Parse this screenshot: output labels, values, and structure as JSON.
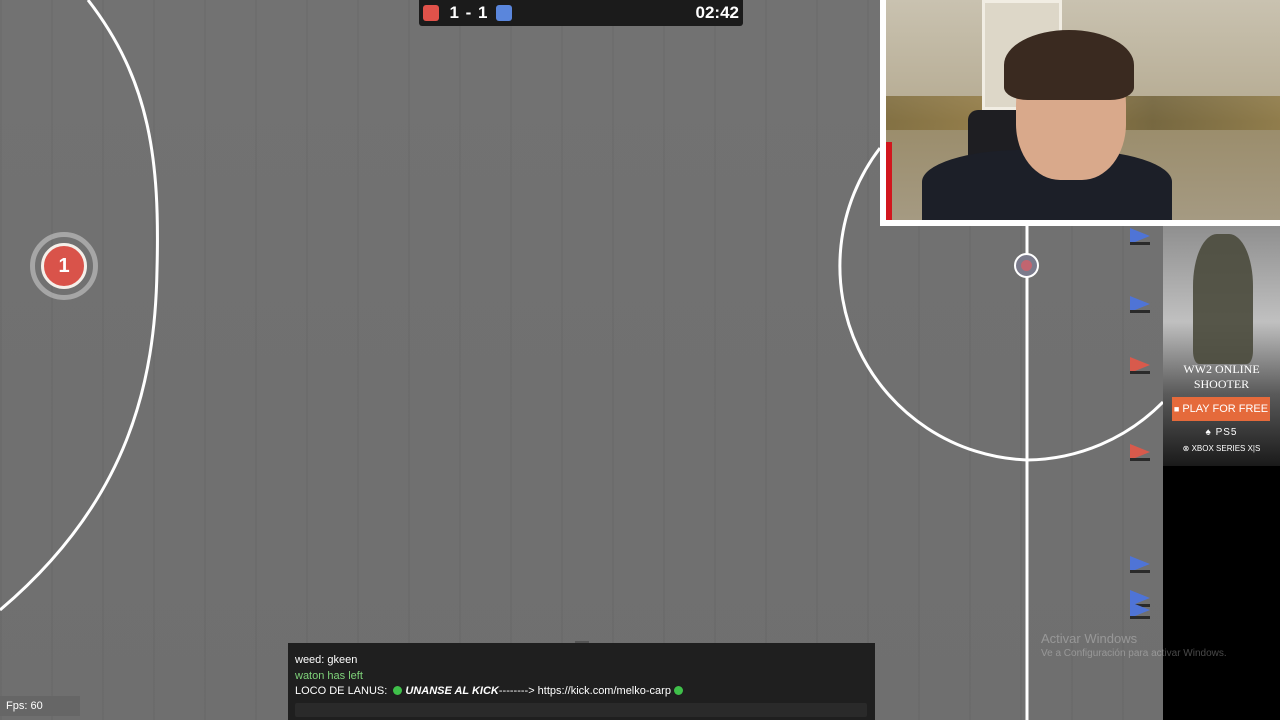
{
  "scoreboard": {
    "red_score": "1",
    "separator": "-",
    "blue_score": "1",
    "score_text": "1 - 1",
    "timer": "02:42",
    "red_color": "#e0524a",
    "blue_color": "#5a86dc"
  },
  "players": {
    "player_1_number": "1"
  },
  "ad": {
    "title": "WW2 ONLINE SHOOTER",
    "cta_label": "PLAY FOR FREE",
    "platform_1": "PS5",
    "platform_2": "XBOX SERIES X|S"
  },
  "watermark": {
    "line_1": "Activar Windows",
    "line_2": "Ve a Configuración para activar Windows."
  },
  "chat": {
    "line_1": "weed: gkeen",
    "line_2": "waton has left",
    "line_3_user": "LOCO DE LANUS:",
    "line_3_bold": "UNANSE AL KICK",
    "line_3_link": "--------> https://kick.com/melko-carp",
    "input_value": "",
    "dot_color": "#3fc04a"
  },
  "fps": "Fps: 60",
  "icons": [
    "windows-icon",
    "playstation-icon",
    "xbox-icon",
    "green-dot-icon"
  ]
}
